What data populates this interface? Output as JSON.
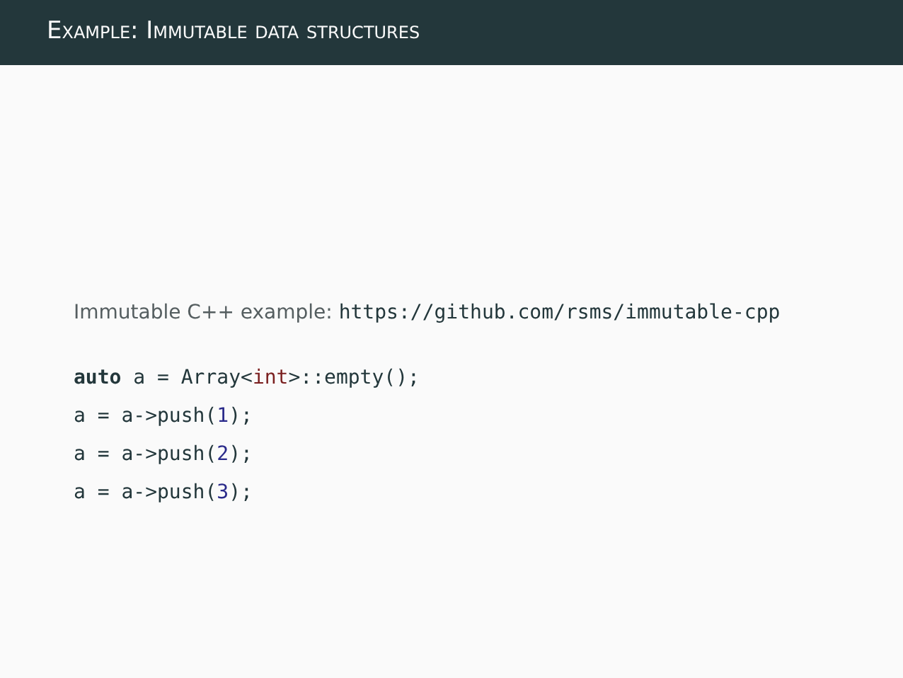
{
  "slide": {
    "title": "Example: Immutable data structures",
    "intro": {
      "text": "Immutable C++ example: ",
      "link": "https://github.com/rsms/immutable-cpp"
    },
    "code_lines": [
      {
        "tokens": [
          {
            "text": "auto",
            "kind": "keyword"
          },
          {
            "text": " a = Array<",
            "kind": "plain"
          },
          {
            "text": "int",
            "kind": "type"
          },
          {
            "text": ">::empty();",
            "kind": "plain"
          }
        ]
      },
      {
        "tokens": [
          {
            "text": "a = a->push(",
            "kind": "plain"
          },
          {
            "text": "1",
            "kind": "number"
          },
          {
            "text": ");",
            "kind": "plain"
          }
        ]
      },
      {
        "tokens": [
          {
            "text": "a = a->push(",
            "kind": "plain"
          },
          {
            "text": "2",
            "kind": "number"
          },
          {
            "text": ");",
            "kind": "plain"
          }
        ]
      },
      {
        "tokens": [
          {
            "text": "a = a->push(",
            "kind": "plain"
          },
          {
            "text": "3",
            "kind": "number"
          },
          {
            "text": ");",
            "kind": "plain"
          }
        ]
      }
    ]
  }
}
